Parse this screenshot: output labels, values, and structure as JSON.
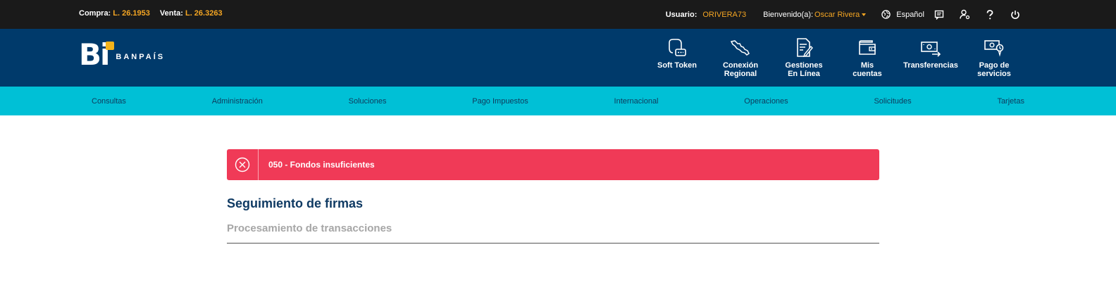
{
  "topbar": {
    "compra_label": "Compra:",
    "compra_value": "L. 26.1953",
    "venta_label": "Venta:",
    "venta_value": "L. 26.3263",
    "usuario_label": "Usuario:",
    "usuario_value": "ORIVERA73",
    "bienvenido_label": "Bienvenido(a):",
    "bienvenido_name": "Oscar Rivera",
    "language": "Español",
    "icons": [
      "globe-icon",
      "messages-icon",
      "user-settings-icon",
      "help-icon",
      "power-icon"
    ]
  },
  "header": {
    "logo_mark": "Bi",
    "logo_text": "BANPAÍS",
    "quick_links": [
      {
        "label": "Soft Token",
        "icon": "soft-token-icon"
      },
      {
        "label": "Conexión\nRegional",
        "icon": "regional-map-icon"
      },
      {
        "label": "Gestiones\nEn Línea",
        "icon": "document-edit-icon"
      },
      {
        "label": "Mis\ncuentas",
        "icon": "wallet-icon"
      },
      {
        "label": "Transferencias",
        "icon": "transfer-money-icon"
      },
      {
        "label": "Pago de\nservicios",
        "icon": "pay-services-icon"
      }
    ]
  },
  "menu": {
    "items": [
      "Consultas",
      "Administración",
      "Soluciones",
      "Pago Impuestos",
      "Internacional",
      "Operaciones",
      "Solicitudes",
      "Tarjetas"
    ]
  },
  "alert": {
    "message": "050 - Fondos insuficientes",
    "icon": "close-circle-icon",
    "color": "#f03a57"
  },
  "main": {
    "title": "Seguimiento de firmas",
    "subtitle": "Procesamiento de transacciones"
  },
  "colors": {
    "topbar": "#1a1a1a",
    "header": "#003a6b",
    "menu": "#00c0d6",
    "accent": "#f5a623"
  }
}
